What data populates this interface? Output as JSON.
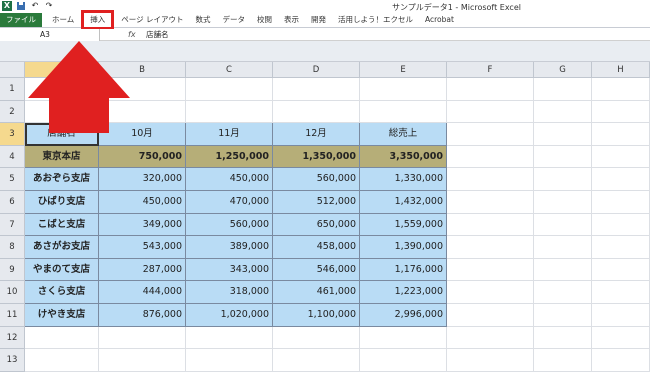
{
  "window": {
    "title": "サンプルデータ1 - Microsoft Excel"
  },
  "qat": {
    "excel_icon": "X",
    "undo": "↶",
    "redo": "↷"
  },
  "ribbon": {
    "tabs": [
      "ファイル",
      "ホーム",
      "挿入",
      "ページ レイアウト",
      "数式",
      "データ",
      "校閲",
      "表示",
      "開発",
      "活用しよう！エクセル",
      "Acrobat"
    ],
    "highlighted_tab": "挿入",
    "highlight_color": "#e02020"
  },
  "formula_bar": {
    "name_box": "A3",
    "fx": "fx",
    "content": "店舗名"
  },
  "columns": [
    "A",
    "B",
    "C",
    "D",
    "E",
    "F",
    "G",
    "H"
  ],
  "rows": [
    "1",
    "2",
    "3",
    "4",
    "5",
    "6",
    "7",
    "8",
    "9",
    "10",
    "11",
    "12",
    "13"
  ],
  "table": {
    "header": [
      "店舗名",
      "10月",
      "11月",
      "12月",
      "総売上"
    ],
    "rows": [
      [
        "東京本店",
        "750,000",
        "1,250,000",
        "1,350,000",
        "3,350,000"
      ],
      [
        "あおぞら支店",
        "320,000",
        "450,000",
        "560,000",
        "1,330,000"
      ],
      [
        "ひばり支店",
        "450,000",
        "470,000",
        "512,000",
        "1,432,000"
      ],
      [
        "こばと支店",
        "349,000",
        "560,000",
        "650,000",
        "1,559,000"
      ],
      [
        "あさがお支店",
        "543,000",
        "389,000",
        "458,000",
        "1,390,000"
      ],
      [
        "やまのて支店",
        "287,000",
        "343,000",
        "546,000",
        "1,176,000"
      ],
      [
        "さくら支店",
        "444,000",
        "318,000",
        "461,000",
        "1,223,000"
      ],
      [
        "けやき支店",
        "876,000",
        "1,020,000",
        "1,100,000",
        "2,996,000"
      ]
    ]
  },
  "colors": {
    "table_fill": "#b9dcf5",
    "total_row_fill": "#b6ae78",
    "arrow": "#e02020",
    "file_tab": "#2a7a3b"
  }
}
